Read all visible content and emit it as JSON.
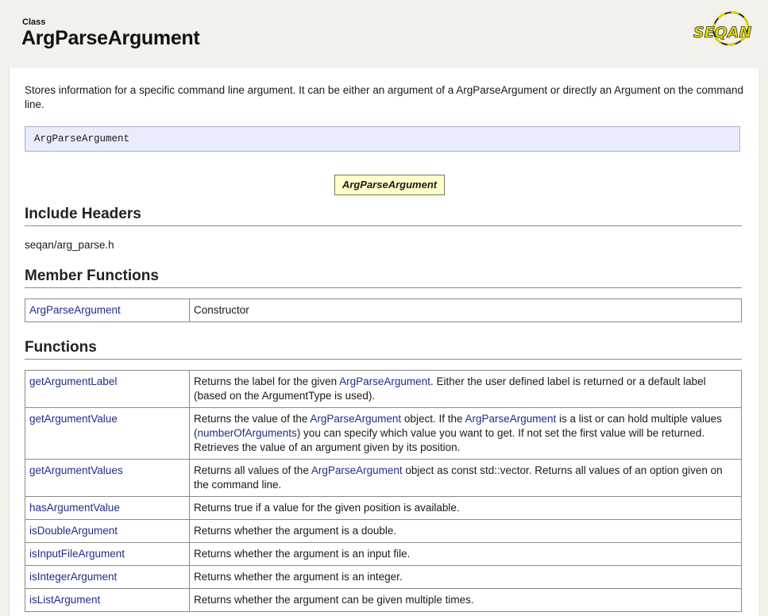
{
  "header": {
    "kind": "Class",
    "title": "ArgParseArgument",
    "logo_text": "SEQAN",
    "logo_icon": "seqan-logo-icon"
  },
  "description": "Stores information for a specific command line argument. It can be either an argument of a ArgParseArgument or directly an Argument on the command line.",
  "signature": "ArgParseArgument",
  "diagram": {
    "node_label": "ArgParseArgument"
  },
  "include_headers": {
    "heading": "Include Headers",
    "path": "seqan/arg_parse.h"
  },
  "member_functions": {
    "heading": "Member Functions",
    "rows": [
      {
        "name": "ArgParseArgument",
        "description": "Constructor"
      }
    ]
  },
  "functions": {
    "heading": "Functions",
    "rows": [
      {
        "name": "getArgumentLabel",
        "d1": "Returns the label for the given ",
        "l1": "ArgParseArgument",
        "d2": ". Either the user defined label is returned or a default label (based on the ArgumentType is used)."
      },
      {
        "name": "getArgumentValue",
        "d1": "Returns the value of the ",
        "l1": "ArgParseArgument",
        "d2": " object. If the ",
        "l2": "ArgParseArgument",
        "d3": " is a list or can hold multiple values (",
        "l3": "numberOfArguments",
        "d4": ") you can specify which value you want to get. If not set the first value will be returned. Retrieves the value of an argument given by its position."
      },
      {
        "name": "getArgumentValues",
        "d1": "Returns all values of the ",
        "l1": "ArgParseArgument",
        "d2": " object as const std::vector. Returns all values of an option given on the command line."
      },
      {
        "name": "hasArgumentValue",
        "d1": "Returns true if a value for the given position is available."
      },
      {
        "name": "isDoubleArgument",
        "d1": "Returns whether the argument is a double."
      },
      {
        "name": "isInputFileArgument",
        "d1": "Returns whether the argument is an input file."
      },
      {
        "name": "isIntegerArgument",
        "d1": "Returns whether the argument is an integer."
      },
      {
        "name": "isListArgument",
        "d1": "Returns whether the argument can be given multiple times."
      }
    ]
  },
  "colors": {
    "link": "#1f2d8a",
    "signature_bg": "#e8ecfb",
    "diagram_node_bg": "#ffffcc",
    "page_bg": "#f2f1ec"
  }
}
